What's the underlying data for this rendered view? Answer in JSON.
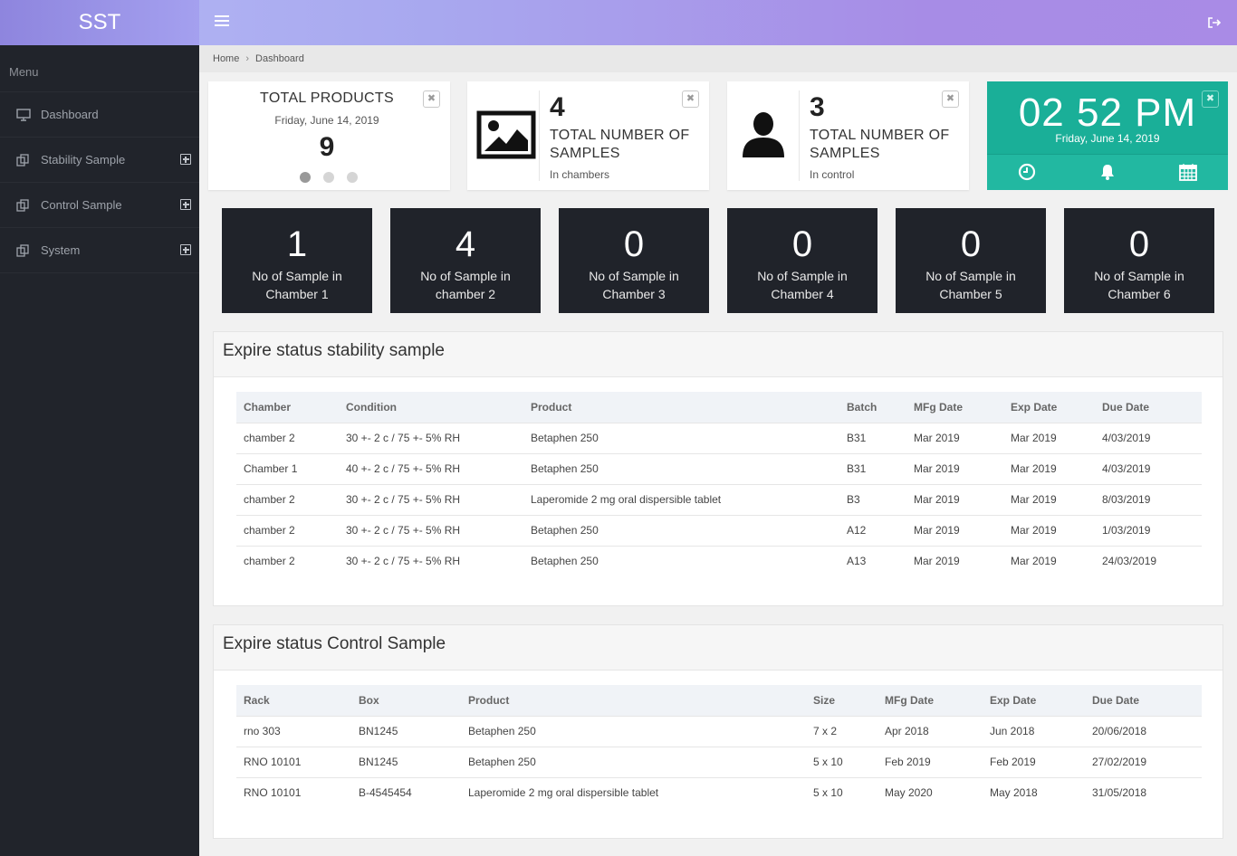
{
  "app": {
    "brand": "SST"
  },
  "sidebar": {
    "menu_label": "Menu",
    "items": [
      {
        "label": "Dashboard",
        "icon": "monitor-icon"
      },
      {
        "label": "Stability Sample",
        "icon": "copy-icon"
      },
      {
        "label": "Control Sample",
        "icon": "copy-icon"
      },
      {
        "label": "System",
        "icon": "copy-icon"
      }
    ]
  },
  "breadcrumb": {
    "home": "Home",
    "separator": "›",
    "current": "Dashboard"
  },
  "cards": {
    "total_products": {
      "title": "TOTAL PRODUCTS",
      "date": "Friday, June 14, 2019",
      "value": "9"
    },
    "samples_chambers": {
      "value": "4",
      "label": "TOTAL NUMBER OF SAMPLES",
      "sub": "In chambers",
      "icon": "image-icon"
    },
    "samples_control": {
      "value": "3",
      "label": "TOTAL NUMBER OF SAMPLES",
      "sub": "In control",
      "icon": "user-icon"
    },
    "clock": {
      "time": "02 52 PM",
      "date": "Friday, June 14, 2019",
      "accent": "#1aaf98"
    }
  },
  "chambers": [
    {
      "value": "1",
      "label": "No of Sample in Chamber 1"
    },
    {
      "value": "4",
      "label": "No of Sample in chamber 2"
    },
    {
      "value": "0",
      "label": "No of Sample in Chamber 3"
    },
    {
      "value": "0",
      "label": "No of Sample in Chamber 4"
    },
    {
      "value": "0",
      "label": "No of Sample in Chamber 5"
    },
    {
      "value": "0",
      "label": "No of Sample in Chamber 6"
    }
  ],
  "stability": {
    "title": "Expire status stability sample",
    "columns": [
      "Chamber",
      "Condition",
      "Product",
      "Batch",
      "MFg Date",
      "Exp Date",
      "Due Date"
    ],
    "rows": [
      [
        "chamber 2",
        "30 +- 2 c / 75 +- 5% RH",
        "Betaphen 250",
        "B31",
        "Mar 2019",
        "Mar 2019",
        "4/03/2019"
      ],
      [
        "Chamber 1",
        "40 +- 2 c / 75 +- 5% RH",
        "Betaphen 250",
        "B31",
        "Mar 2019",
        "Mar 2019",
        "4/03/2019"
      ],
      [
        "chamber 2",
        "30 +- 2 c / 75 +- 5% RH",
        "Laperomide 2 mg oral dispersible tablet",
        "B3",
        "Mar 2019",
        "Mar 2019",
        "8/03/2019"
      ],
      [
        "chamber 2",
        "30 +- 2 c / 75 +- 5% RH",
        "Betaphen 250",
        "A12",
        "Mar 2019",
        "Mar 2019",
        "1/03/2019"
      ],
      [
        "chamber 2",
        "30 +- 2 c / 75 +- 5% RH",
        "Betaphen 250",
        "A13",
        "Mar 2019",
        "Mar 2019",
        "24/03/2019"
      ]
    ]
  },
  "control": {
    "title": "Expire status Control Sample",
    "columns": [
      "Rack",
      "Box",
      "Product",
      "Size",
      "MFg Date",
      "Exp Date",
      "Due Date"
    ],
    "rows": [
      [
        "rno 303",
        "BN1245",
        "Betaphen 250",
        "7 x 2",
        "Apr 2018",
        "Jun 2018",
        "20/06/2018"
      ],
      [
        "RNO 10101",
        "BN1245",
        "Betaphen 250",
        "5 x 10",
        "Feb 2019",
        "Feb 2019",
        "27/02/2019"
      ],
      [
        "RNO 10101",
        "B-4545454",
        "Laperomide 2 mg oral dispersible tablet",
        "5 x 10",
        "May 2020",
        "May 2018",
        "31/05/2018"
      ]
    ]
  }
}
